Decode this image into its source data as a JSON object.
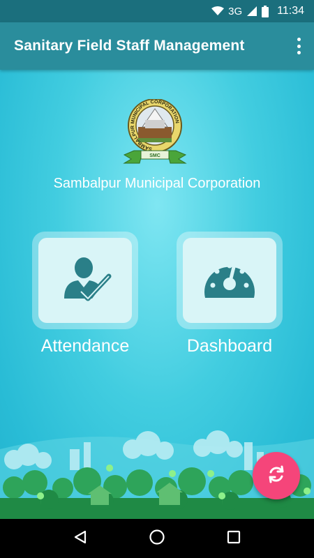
{
  "status_bar": {
    "network": "3G",
    "time": "11:34"
  },
  "app_bar": {
    "title": "Sanitary Field Staff Management",
    "menu_icon": "more-vert-icon"
  },
  "org": {
    "name": "Sambalpur Municipal Corporation",
    "logo_ring_text": "SAMBALPUR MUNICIPAL CORPORATION",
    "logo_banner": "SMC"
  },
  "tiles": [
    {
      "label": "Attendance",
      "icon": "person-check-icon"
    },
    {
      "label": "Dashboard",
      "icon": "speedometer-icon"
    }
  ],
  "fab": {
    "icon": "refresh-icon"
  },
  "colors": {
    "app_bar": "#2a8d9c",
    "status_bar": "#1b6f7d",
    "background": "#42cde0",
    "fab": "#f5457a",
    "tile": "#d9f5f7",
    "icon": "#2a7f88"
  },
  "nav": {
    "icons": [
      "back-icon",
      "home-icon",
      "recents-icon"
    ]
  }
}
